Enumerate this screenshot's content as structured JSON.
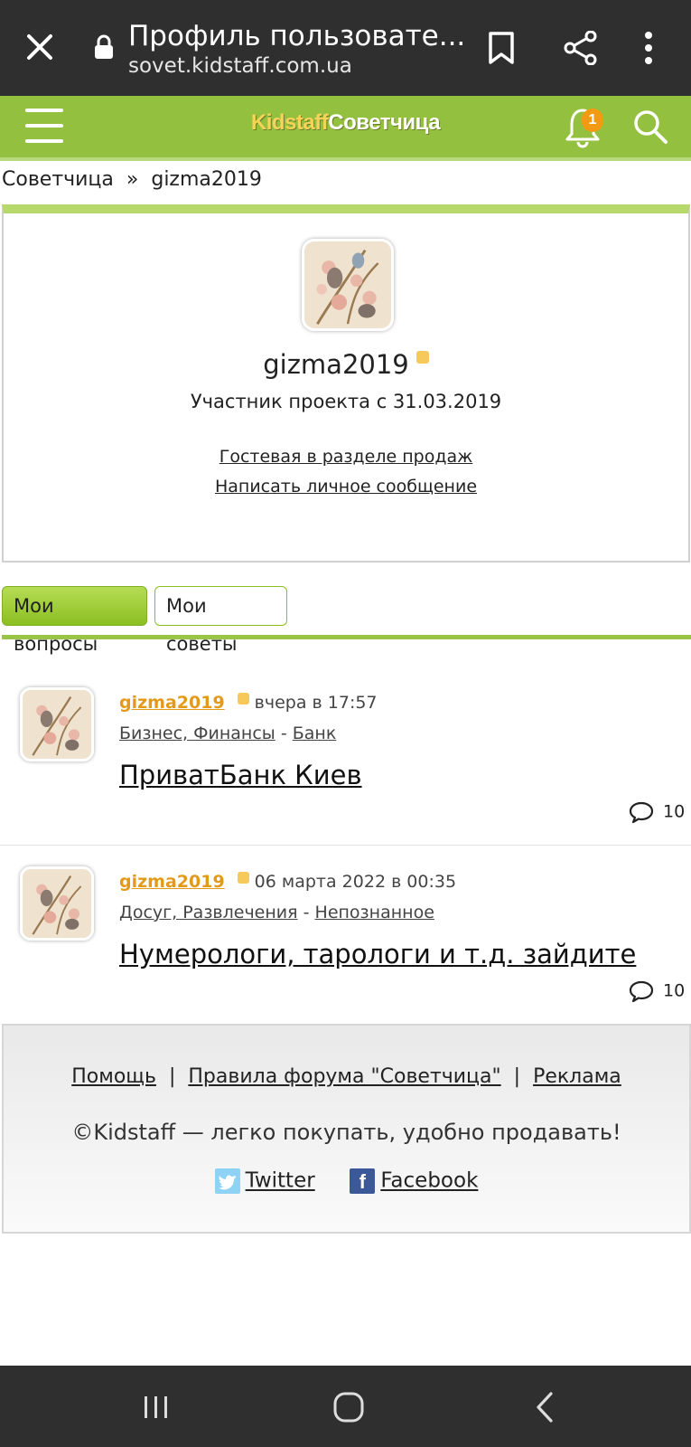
{
  "browser": {
    "title": "Профиль пользовате...",
    "url": "sovet.kidstaff.com.ua"
  },
  "site": {
    "logo_part1": "Kidstaff",
    "logo_part2": "Советчица",
    "notification_count": "1"
  },
  "breadcrumb": {
    "home": "Советчица",
    "separator": "»",
    "current": "gizma2019"
  },
  "profile": {
    "username": "gizma2019",
    "member_since": "Участник проекта с 31.03.2019",
    "guestbook_link": "Гостевая в разделе продаж",
    "message_link": "Написать личное сообщение"
  },
  "tabs": [
    {
      "label": "Мои вопросы",
      "active": true
    },
    {
      "label": "Мои советы",
      "active": false
    }
  ],
  "questions": [
    {
      "author": "gizma2019",
      "time": "вчера в 17:57",
      "category": "Бизнес, Финансы",
      "cat_sep": "-",
      "subcategory": "Банк",
      "title": "ПриватБанк Киев",
      "comments": "10"
    },
    {
      "author": "gizma2019",
      "time": "06 марта 2022 в 00:35",
      "category": "Досуг, Развлечения",
      "cat_sep": "-",
      "subcategory": "Непознанное",
      "title": "Нумерологи, тарологи и т.д. зайдите",
      "comments": "10"
    }
  ],
  "footer": {
    "help": "Помощь",
    "pipe": "|",
    "rules": "Правила форума \"Советчица\"",
    "ads": "Реклама",
    "copyright": "©Kidstaff — легко покупать, удобно продавать!",
    "twitter": "Twitter",
    "facebook": "Facebook",
    "facebook_glyph": "f"
  },
  "colors": {
    "header_green": "#93c13f",
    "accent_orange": "#e39a1b",
    "online_yellow": "#f7c95a",
    "chrome_dark": "#2f2f2f"
  },
  "icons": [
    "close-icon",
    "lock-icon",
    "bookmark-icon",
    "share-icon",
    "more-icon",
    "menu-icon",
    "bell-icon",
    "search-icon",
    "comment-icon",
    "twitter-icon",
    "facebook-icon"
  ]
}
